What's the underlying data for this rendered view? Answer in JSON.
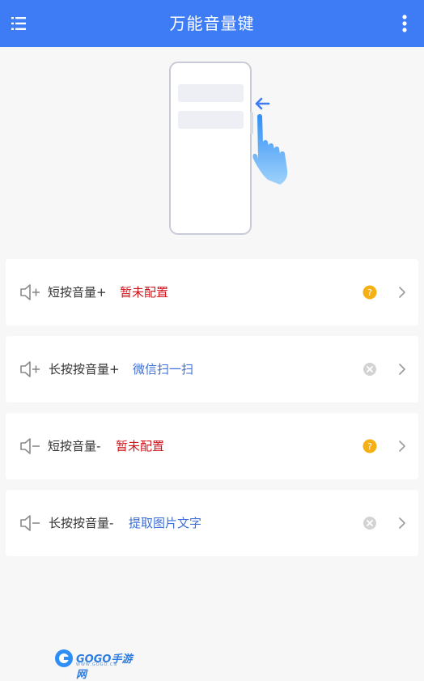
{
  "appbar": {
    "title": "万能音量键",
    "menu_icon": "list-menu-icon",
    "more_icon": "more-vertical-icon",
    "color": "#3d7cf4"
  },
  "hero": {
    "icon": "phone-swipe-hand-illustration"
  },
  "items": [
    {
      "label": "短按音量+",
      "value": "暂未配置",
      "value_color": "#d0141b",
      "vol_icon": "volume-plus-icon",
      "status_icon": "help-icon"
    },
    {
      "label": "长按按音量+",
      "value": "微信扫一扫",
      "value_color": "#3d6fd6",
      "vol_icon": "volume-plus-icon",
      "status_icon": "clear-icon"
    },
    {
      "label": "短按音量-",
      "value": "暂未配置",
      "value_color": "#d0141b",
      "vol_icon": "volume-minus-icon",
      "status_icon": "help-icon"
    },
    {
      "label": "长按按音量-",
      "value": "提取图片文字",
      "value_color": "#3d6fd6",
      "vol_icon": "volume-minus-icon",
      "status_icon": "clear-icon"
    }
  ],
  "watermark": {
    "text": "GOGO手游网",
    "sub": "WWW.GOGO.CN"
  }
}
